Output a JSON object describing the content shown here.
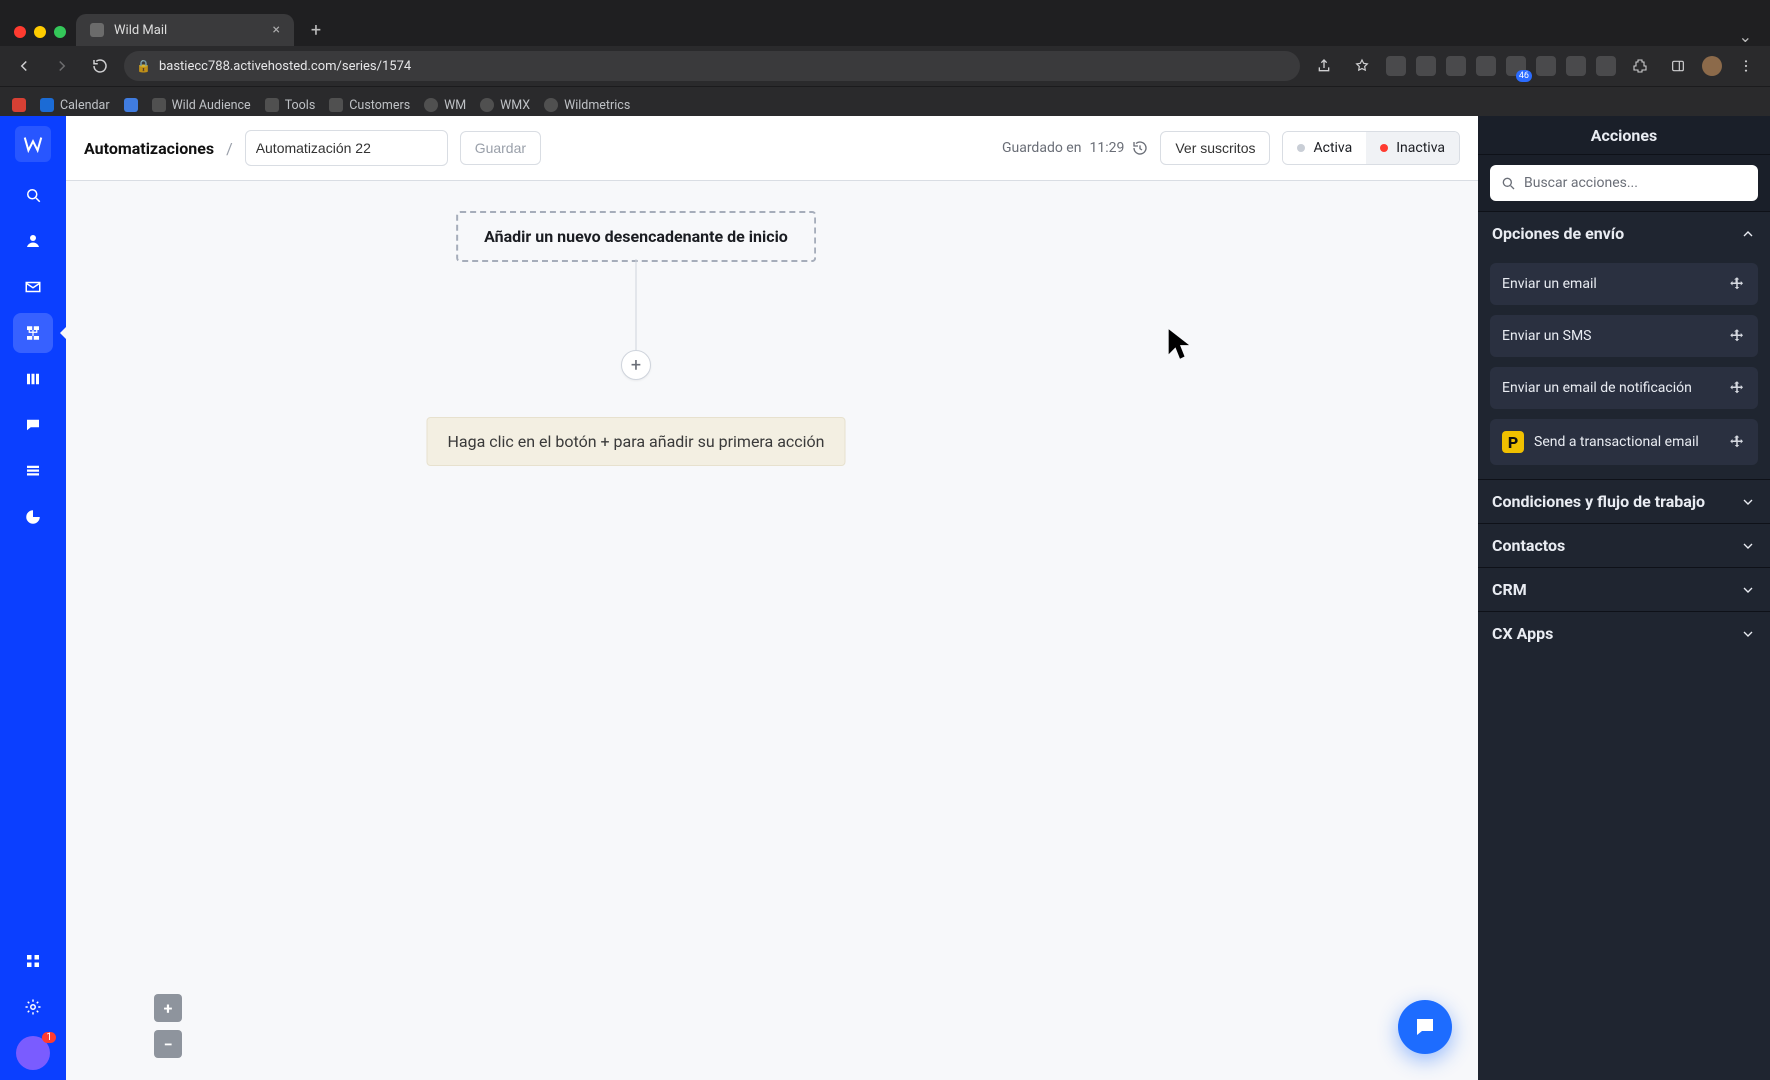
{
  "browser": {
    "tab_title": "Wild Mail",
    "url": "bastiecc788.activehosted.com/series/1574",
    "bookmarks": [
      "Calendar",
      "Wild Audience",
      "Tools",
      "Customers",
      "WM",
      "WMX",
      "Wildmetrics"
    ],
    "ext_badge": "46"
  },
  "sidebar": {
    "avatar_badge": "1"
  },
  "topbar": {
    "breadcrumb": "Automatizaciones",
    "name_value": "Automatización 22",
    "save_label": "Guardar",
    "saved_prefix": "Guardado en",
    "saved_time": "11:29",
    "view_subs": "Ver suscritos",
    "active_label": "Activa",
    "inactive_label": "Inactiva"
  },
  "canvas": {
    "trigger_text": "Añadir un nuevo desencadenante de inicio",
    "hint_text": "Haga clic en el botón + para añadir su primera acción"
  },
  "actions": {
    "title": "Acciones",
    "search_placeholder": "Buscar acciones...",
    "sections": {
      "send": {
        "title": "Opciones de envío",
        "items": [
          {
            "label": "Enviar un email",
            "kind": "email"
          },
          {
            "label": "Enviar un SMS",
            "kind": "sms"
          },
          {
            "label": "Enviar un email de notificación",
            "kind": "notify"
          },
          {
            "label": "Send a transactional email",
            "kind": "postmark"
          }
        ]
      },
      "conditions": {
        "title": "Condiciones y flujo de trabajo"
      },
      "contacts": {
        "title": "Contactos"
      },
      "crm": {
        "title": "CRM"
      },
      "cx": {
        "title": "CX Apps"
      }
    }
  }
}
